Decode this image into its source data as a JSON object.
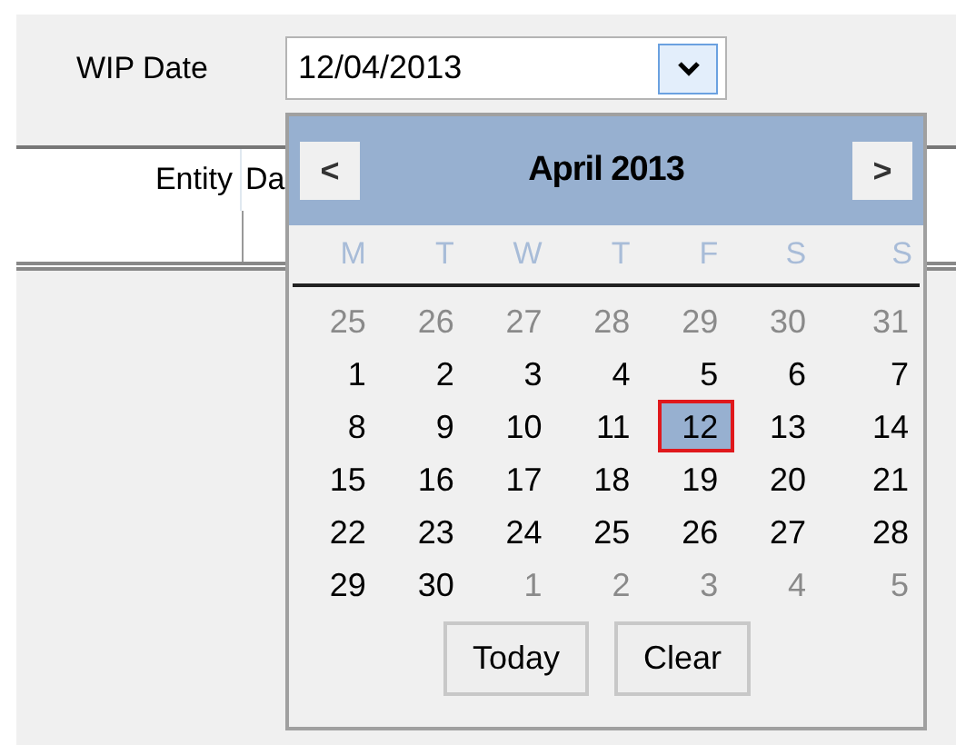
{
  "filter": {
    "label": "WIP Date",
    "value": "12/04/2013"
  },
  "grid": {
    "columns": [
      "Entity",
      "Da"
    ]
  },
  "calendar": {
    "title": "April 2013",
    "prev": "<",
    "next": ">",
    "weekdays": [
      "M",
      "T",
      "W",
      "T",
      "F",
      "S",
      "S"
    ],
    "days": [
      {
        "label": "25",
        "other_month": true,
        "selected": false
      },
      {
        "label": "26",
        "other_month": true,
        "selected": false
      },
      {
        "label": "27",
        "other_month": true,
        "selected": false
      },
      {
        "label": "28",
        "other_month": true,
        "selected": false
      },
      {
        "label": "29",
        "other_month": true,
        "selected": false
      },
      {
        "label": "30",
        "other_month": true,
        "selected": false
      },
      {
        "label": "31",
        "other_month": true,
        "selected": false
      },
      {
        "label": "1",
        "other_month": false,
        "selected": false
      },
      {
        "label": "2",
        "other_month": false,
        "selected": false
      },
      {
        "label": "3",
        "other_month": false,
        "selected": false
      },
      {
        "label": "4",
        "other_month": false,
        "selected": false
      },
      {
        "label": "5",
        "other_month": false,
        "selected": false
      },
      {
        "label": "6",
        "other_month": false,
        "selected": false
      },
      {
        "label": "7",
        "other_month": false,
        "selected": false
      },
      {
        "label": "8",
        "other_month": false,
        "selected": false
      },
      {
        "label": "9",
        "other_month": false,
        "selected": false
      },
      {
        "label": "10",
        "other_month": false,
        "selected": false
      },
      {
        "label": "11",
        "other_month": false,
        "selected": false
      },
      {
        "label": "12",
        "other_month": false,
        "selected": true
      },
      {
        "label": "13",
        "other_month": false,
        "selected": false
      },
      {
        "label": "14",
        "other_month": false,
        "selected": false
      },
      {
        "label": "15",
        "other_month": false,
        "selected": false
      },
      {
        "label": "16",
        "other_month": false,
        "selected": false
      },
      {
        "label": "17",
        "other_month": false,
        "selected": false
      },
      {
        "label": "18",
        "other_month": false,
        "selected": false
      },
      {
        "label": "19",
        "other_month": false,
        "selected": false
      },
      {
        "label": "20",
        "other_month": false,
        "selected": false
      },
      {
        "label": "21",
        "other_month": false,
        "selected": false
      },
      {
        "label": "22",
        "other_month": false,
        "selected": false
      },
      {
        "label": "23",
        "other_month": false,
        "selected": false
      },
      {
        "label": "24",
        "other_month": false,
        "selected": false
      },
      {
        "label": "25",
        "other_month": false,
        "selected": false
      },
      {
        "label": "26",
        "other_month": false,
        "selected": false
      },
      {
        "label": "27",
        "other_month": false,
        "selected": false
      },
      {
        "label": "28",
        "other_month": false,
        "selected": false
      },
      {
        "label": "29",
        "other_month": false,
        "selected": false
      },
      {
        "label": "30",
        "other_month": false,
        "selected": false
      },
      {
        "label": "1",
        "other_month": true,
        "selected": false
      },
      {
        "label": "2",
        "other_month": true,
        "selected": false
      },
      {
        "label": "3",
        "other_month": true,
        "selected": false
      },
      {
        "label": "4",
        "other_month": true,
        "selected": false
      },
      {
        "label": "5",
        "other_month": true,
        "selected": false
      }
    ],
    "buttons": [
      "Today",
      "Clear"
    ]
  }
}
